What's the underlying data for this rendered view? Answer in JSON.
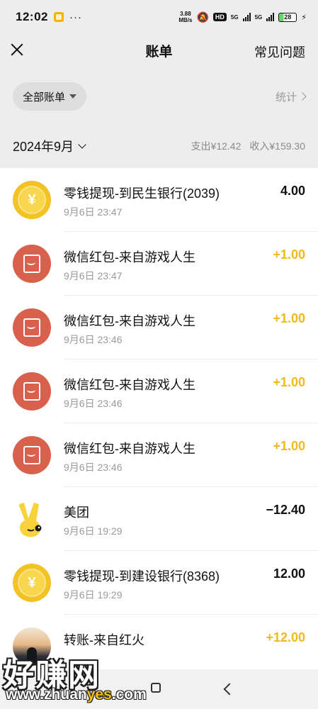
{
  "status_bar": {
    "time": "12:02",
    "dots": "···",
    "net_speed_value": "3.88",
    "net_speed_unit": "MB/s",
    "hd_label": "HD",
    "signal1_label": "5G",
    "signal2_label": "5G",
    "battery_level": "28",
    "icons": [
      "app-notification-icon",
      "mute-icon",
      "signal-icon",
      "battery-icon",
      "charging-icon"
    ]
  },
  "nav": {
    "title": "账单",
    "faq_label": "常见问题"
  },
  "filter": {
    "selected_label": "全部账单",
    "stats_label": "统计"
  },
  "month": {
    "label": "2024年9月",
    "expense": "支出¥12.42",
    "income": "收入¥159.30"
  },
  "colors": {
    "income_amount": "#f1b91c",
    "coin": "#f3c326",
    "red_packet": "#d8604c",
    "background": "#ededed"
  },
  "transactions": [
    {
      "icon": "coin-icon",
      "title": "零钱提现-到民生银行(2039)",
      "date": "9月6日 23:47",
      "amount": "4.00",
      "type": "withdraw"
    },
    {
      "icon": "red-packet-icon",
      "title": "微信红包-来自游戏人生",
      "date": "9月6日 23:47",
      "amount": "+1.00",
      "type": "income"
    },
    {
      "icon": "red-packet-icon",
      "title": "微信红包-来自游戏人生",
      "date": "9月6日 23:46",
      "amount": "+1.00",
      "type": "income"
    },
    {
      "icon": "red-packet-icon",
      "title": "微信红包-来自游戏人生",
      "date": "9月6日 23:46",
      "amount": "+1.00",
      "type": "income"
    },
    {
      "icon": "red-packet-icon",
      "title": "微信红包-来自游戏人生",
      "date": "9月6日 23:46",
      "amount": "+1.00",
      "type": "income"
    },
    {
      "icon": "meituan-logo-icon",
      "title": "美团",
      "date": "9月6日 19:29",
      "amount": "−12.40",
      "type": "expense"
    },
    {
      "icon": "coin-icon",
      "title": "零钱提现-到建设银行(8368)",
      "date": "9月6日 19:29",
      "amount": "12.00",
      "type": "withdraw"
    },
    {
      "icon": "avatar-icon",
      "title": "转账-来自红火",
      "date": "",
      "amount": "+12.00",
      "type": "income"
    }
  ],
  "watermark": {
    "main": "好赚网",
    "sub_prefix": "www.zhuan",
    "sub_accent": "yes",
    "sub_suffix": ".com"
  }
}
